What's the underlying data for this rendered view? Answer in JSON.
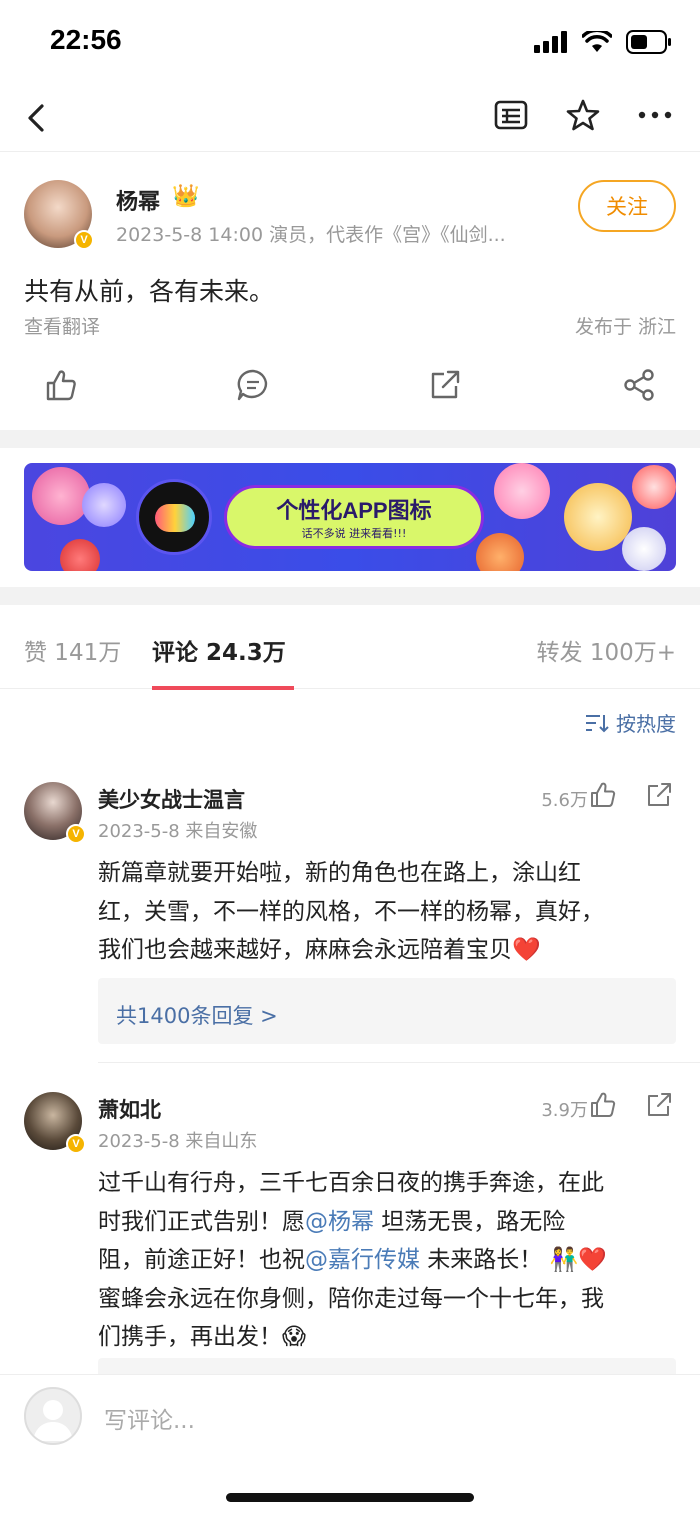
{
  "status_bar": {
    "time": "22:56"
  },
  "post": {
    "author": "杨幂",
    "crown": "👑",
    "meta": "2023-5-8 14:00   演员，代表作《宫》《仙剑...",
    "follow_label": "关注",
    "text": "共有从前，各有未来。",
    "translate_label": "查看翻译",
    "location": "发布于 浙江"
  },
  "banner": {
    "title": "个性化APP图标",
    "subtitle": "话不多说 进来看看!!!"
  },
  "tabs": {
    "likes": "赞 141万",
    "comments": "评论 24.3万",
    "reposts": "转发 100万+"
  },
  "sort_label": "按热度",
  "comments": [
    {
      "name": "美少女战士温言",
      "meta": "2023-5-8   来自安徽",
      "likes": "5.6万",
      "lines": [
        "新篇章就要开始啦，新的角色也在路上，涂山红",
        "红，关雪，不一样的风格，不一样的杨幂，真好，",
        "我们也会越来越好，麻麻会永远陪着宝贝"
      ],
      "heart": "❤️",
      "replies": "共1400条回复 >"
    },
    {
      "name": "萧如北",
      "meta": "2023-5-8   来自山东",
      "likes": "3.9万",
      "line1": "过千山有行舟，三千七百余日夜的携手奔途，在此",
      "line2_a": "时我们正式告别！愿",
      "mention1": "@杨幂",
      "line2_b": " 坦荡无畏，路无险",
      "line3_a": "阻，前途正好！也祝",
      "mention2": "@嘉行传媒",
      "line3_b": " 未来路长！",
      "emoji_family": "👫",
      "emoji_heart": "❤️",
      "line4": "蜜蜂会永远在你身侧，陪你走过每一个十七年，我",
      "line5": "们携手，再出发！",
      "emoji_end": "😱"
    }
  ],
  "bottom": {
    "placeholder": "写评论..."
  },
  "colors": {
    "accent": "#ef4a5a",
    "follow": "#f5a623",
    "link": "#4a6fa5",
    "verified": "#f5b400"
  }
}
